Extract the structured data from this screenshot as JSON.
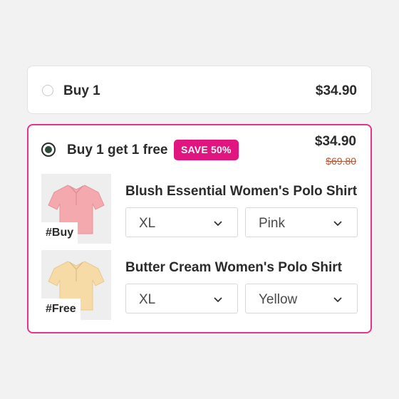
{
  "offers": {
    "single": {
      "label": "Buy 1",
      "price": "$34.90"
    },
    "bundle": {
      "label": "Buy 1 get 1 free",
      "badge": "SAVE 50%",
      "price": "$34.90",
      "original_price": "$69.80",
      "items": [
        {
          "tag": "#Buy",
          "name": "Blush Essential Women's Polo Shirt",
          "size": "XL",
          "color": "Pink",
          "shirt_color": "#f4a9ae"
        },
        {
          "tag": "#Free",
          "name": "Butter Cream Women's Polo Shirt",
          "size": "XL",
          "color": "Yellow",
          "shirt_color": "#f7dba6"
        }
      ]
    }
  },
  "colors": {
    "accent": "#e0157f",
    "border_selected": "#e8328c",
    "strike_price": "#b05a3a"
  }
}
